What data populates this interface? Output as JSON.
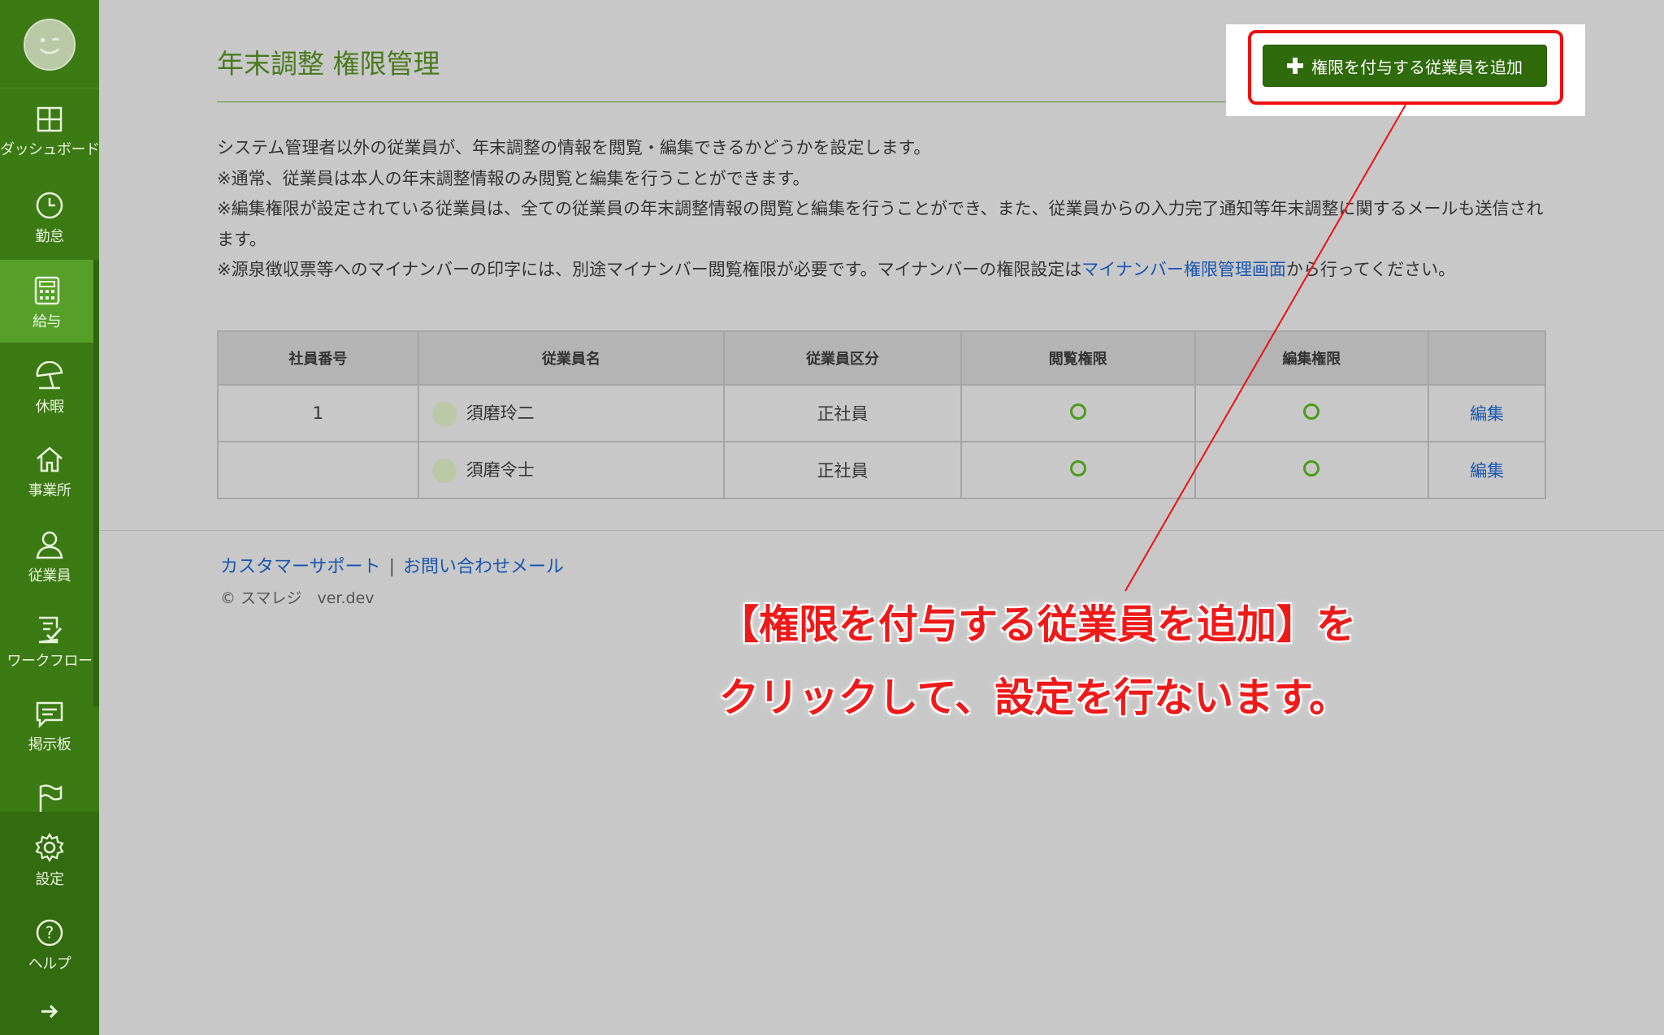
{
  "sidebar": {
    "items": [
      {
        "label": "ダッシュボード",
        "icon": "dashboard-icon"
      },
      {
        "label": "勤怠",
        "icon": "clock-icon"
      },
      {
        "label": "給与",
        "icon": "calculator-icon",
        "active": true
      },
      {
        "label": "休暇",
        "icon": "beach-umbrella-icon"
      },
      {
        "label": "事業所",
        "icon": "home-icon"
      },
      {
        "label": "従業員",
        "icon": "person-icon"
      },
      {
        "label": "ワークフロー",
        "icon": "checklist-icon"
      },
      {
        "label": "掲示板",
        "icon": "message-icon"
      },
      {
        "label": "",
        "icon": "flag-icon"
      },
      {
        "label": "設定",
        "icon": "gear-icon"
      },
      {
        "label": "ヘルプ",
        "icon": "help-icon"
      }
    ],
    "expand_icon": "arrow-right-icon"
  },
  "page": {
    "title": "年末調整 権限管理",
    "add_button_label": "権限を付与する従業員を追加"
  },
  "description": {
    "line1": "システム管理者以外の従業員が、年末調整の情報を閲覧・編集できるかどうかを設定します。",
    "line2": "※通常、従業員は本人の年末調整情報のみ閲覧と編集を行うことができます。",
    "line3": "※編集権限が設定されている従業員は、全ての従業員の年末調整情報の閲覧と編集を行うことができ、また、従業員からの入力完了通知等年末調整に関するメールも送信されます。",
    "line4_before": "※源泉徴収票等へのマイナンバーの印字には、別途マイナンバー閲覧権限が必要です。マイナンバーの権限設定は",
    "line4_link": "マイナンバー権限管理画面",
    "line4_after": "から行ってください。"
  },
  "table": {
    "headers": [
      "社員番号",
      "従業員名",
      "従業員区分",
      "閲覧権限",
      "編集権限",
      ""
    ],
    "rows": [
      {
        "id": "1",
        "name": "須磨玲二",
        "type": "正社員",
        "view": true,
        "edit": true,
        "action": "編集"
      },
      {
        "id": "",
        "name": "須磨令士",
        "type": "正社員",
        "view": true,
        "edit": true,
        "action": "編集"
      }
    ]
  },
  "footer": {
    "support_link": "カスタマーサポート",
    "separator": "|",
    "contact_link": "お問い合わせメール",
    "copyright": "© スマレジ　ver.dev"
  },
  "annotation": {
    "line1": "【権限を付与する従業員を追加】を",
    "line2": "クリックして、設定を行ないます。",
    "color": "#ee1a1a"
  },
  "colors": {
    "sidebar": "#3c7a14",
    "sidebar_active": "#56a02a",
    "primary_button": "#2f6a0b",
    "link": "#1a56b0",
    "title": "#4a7a1e"
  }
}
